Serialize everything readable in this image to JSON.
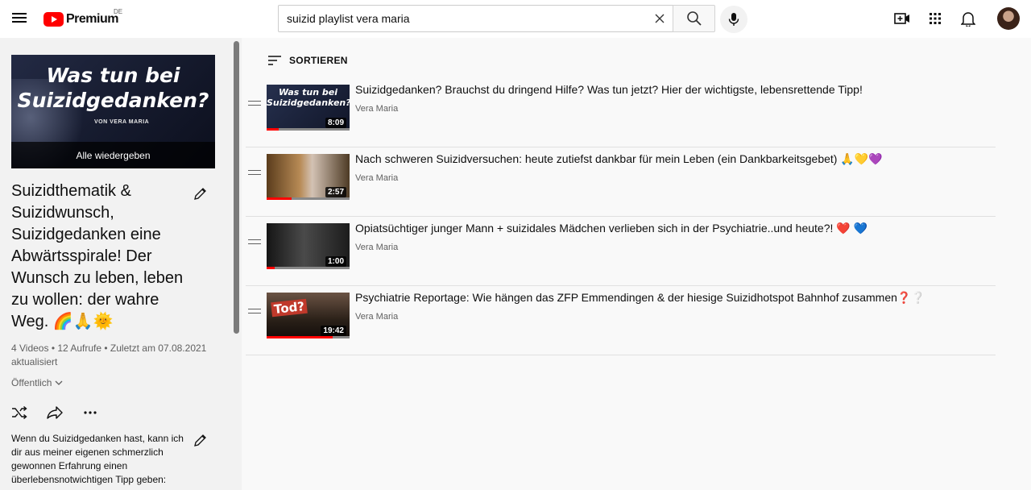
{
  "header": {
    "logo_text": "Premium",
    "country": "DE",
    "search_value": "suizid playlist vera maria",
    "icons": [
      "menu-icon",
      "youtube-logo-icon",
      "clear-icon",
      "search-icon",
      "mic-icon",
      "create-video-icon",
      "apps-icon",
      "notifications-icon",
      "avatar"
    ]
  },
  "playlist": {
    "play_all": "Alle wiedergeben",
    "thumb_title": "Was tun bei Suizidgedanken?",
    "thumb_sub": "VON VERA MARIA",
    "title": "Suizidthematik & Suizidwunsch, Suizidgedanken eine Abwärtsspirale! Der Wunsch zu leben, leben zu wollen: der wahre Weg. 🌈🙏🌞",
    "stats": "4 Videos • 12 Aufrufe • Zuletzt am 07.08.2021 aktualisiert",
    "privacy": "Öffentlich",
    "description": "Wenn du Suizidgedanken hast, kann ich dir aus meiner eigenen schmerzlich gewonnen Erfahrung einen überlebensnotwichtigen Tipp geben:"
  },
  "sort_label": "SORTIEREN",
  "videos": [
    {
      "title": "Suizidgedanken? Brauchst du dringend Hilfe? Was tun jetzt? Hier der wichtigste, lebensrettende Tipp!",
      "channel": "Vera Maria",
      "duration": "8:09",
      "thumb_text": "Was tun bei Suizidgedanken?",
      "progress": 0.15
    },
    {
      "title": "Nach schweren Suizidversuchen: heute zutiefst dankbar für mein Leben (ein Dankbarkeitsgebet) 🙏💛💜",
      "channel": "Vera Maria",
      "duration": "2:57",
      "progress": 0.3
    },
    {
      "title": "Opiatsüchtiger junger Mann + suizidales Mädchen verlieben sich in der Psychiatrie..und heute?! ❤️ 💙",
      "channel": "Vera Maria",
      "duration": "1:00",
      "progress": 0.1
    },
    {
      "title": "Psychiatrie Reportage: Wie hängen das ZFP Emmendingen & der hiesige Suizidhotspot Bahnhof zusammen❓❔",
      "channel": "Vera Maria",
      "duration": "19:42",
      "thumb_text": "Tod?",
      "progress": 0.8
    }
  ],
  "colors": {
    "brand_red": "#ff0000",
    "text": "#0f0f0f",
    "secondary": "#606060"
  }
}
